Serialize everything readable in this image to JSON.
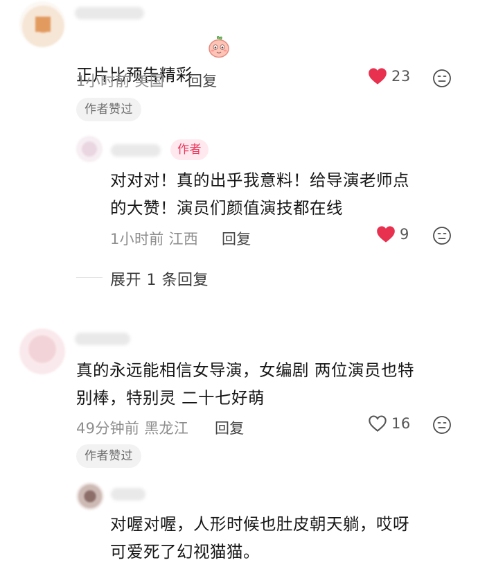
{
  "comments": [
    {
      "text": "正片比预告精彩",
      "emoji_icon": "peach-face-emoji",
      "time": "1小时前",
      "location": "美国",
      "reply_label": "回复",
      "likes": "23",
      "liked": true,
      "badge": "作者赞过",
      "replies": [
        {
          "author_badge": "作者",
          "text": "对对对！真的出乎我意料！给导演老师点\n的大赞！演员们颜值演技都在线",
          "time": "1小时前",
          "location": "江西",
          "reply_label": "回复",
          "likes": "9",
          "liked": true
        }
      ],
      "expand_label": "展开 1 条回复"
    },
    {
      "text": "真的永远能相信女导演，女编剧 两位演员也特\n别棒，特别灵 二十七好萌",
      "time": "49分钟前",
      "location": "黑龙江",
      "reply_label": "回复",
      "likes": "16",
      "liked": false,
      "badge": "作者赞过",
      "replies": [
        {
          "text": "对喔对喔，人形时候也肚皮朝天躺，哎呀\n可爱死了幻视猫猫。"
        }
      ]
    }
  ],
  "colors": {
    "liked_heart": "#e8304f",
    "author_badge_text": "#e83a5e",
    "author_badge_bg": "#ffe9ee"
  }
}
